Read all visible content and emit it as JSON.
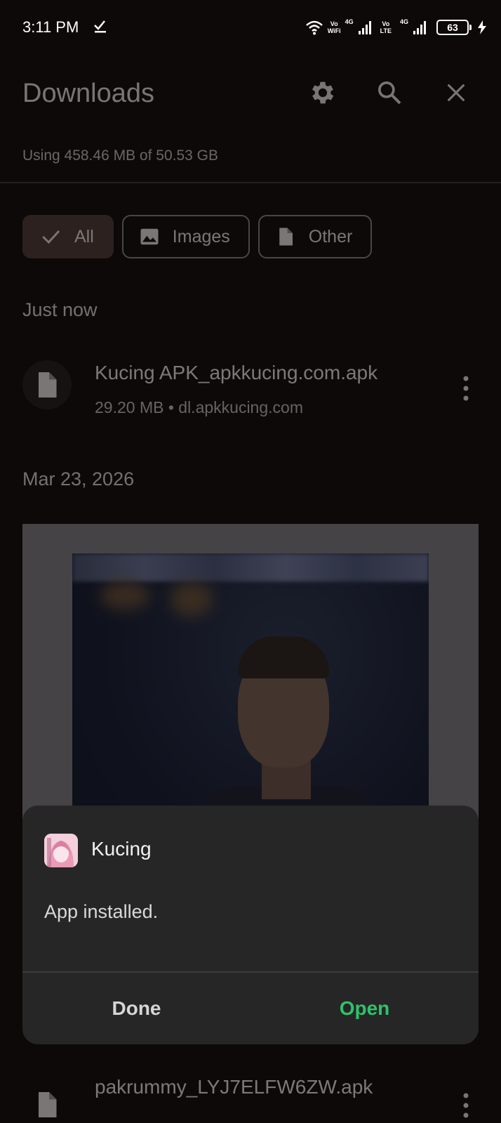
{
  "status_bar": {
    "time": "3:11 PM",
    "wifi_label_top": "Vo",
    "wifi_label_bottom": "WiFi",
    "net1": "4G",
    "volte_top": "Vo",
    "volte_bottom": "LTE",
    "net2": "4G",
    "battery": "63"
  },
  "header": {
    "title": "Downloads",
    "storage": "Using 458.46 MB of 50.53 GB",
    "icons": [
      "gear-icon",
      "search-icon",
      "close-icon"
    ]
  },
  "filters": [
    {
      "label": "All",
      "icon": "check-icon",
      "selected": true
    },
    {
      "label": "Images",
      "icon": "image-icon",
      "selected": false
    },
    {
      "label": "Other",
      "icon": "file-icon",
      "selected": false
    }
  ],
  "sections": {
    "just_now": "Just now",
    "date": "Mar 23, 2026"
  },
  "downloads": {
    "item1": {
      "name": "Kucing APK_apkkucing.com.apk",
      "meta": "29.20 MB • dl.apkkucing.com"
    },
    "item2": {
      "name": "pakrummy_LYJ7ELFW6ZW.apk"
    }
  },
  "dialog": {
    "app_name": "Kucing",
    "message": "App installed.",
    "done_label": "Done",
    "open_label": "Open",
    "open_color": "#2fc26a"
  }
}
